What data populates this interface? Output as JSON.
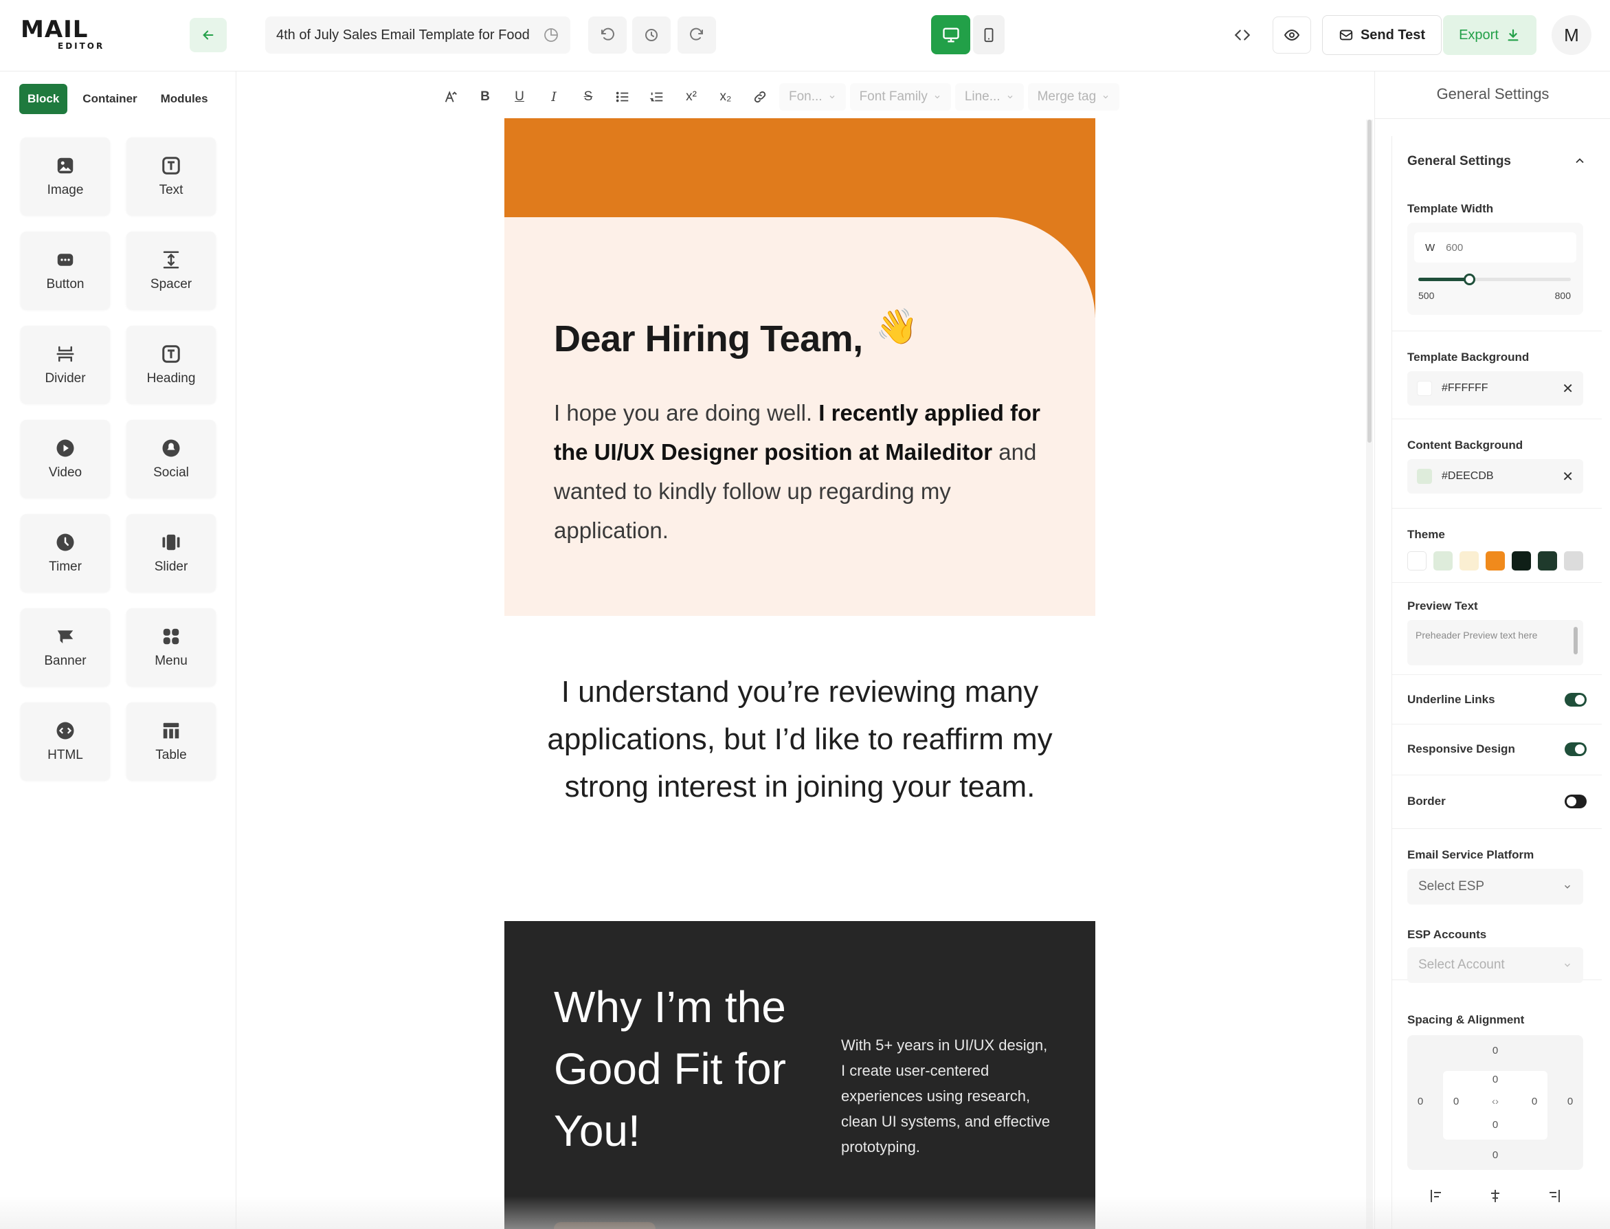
{
  "app": {
    "logo": {
      "main": "MAIL",
      "sub": "EDITOR"
    },
    "template_title": "4th of July Sales Email Template for Food",
    "send_test_label": "Send Test",
    "export_label": "Export",
    "avatar_letter": "M"
  },
  "left": {
    "tabs": [
      "Block",
      "Container",
      "Modules"
    ],
    "blocks": [
      "Image",
      "Text",
      "Button",
      "Spacer",
      "Divider",
      "Heading",
      "Video",
      "Social",
      "Timer",
      "Slider",
      "Banner",
      "Menu",
      "HTML",
      "Table"
    ]
  },
  "toolbar": {
    "font_size": "Fon...",
    "font_family": "Font Family",
    "line_height": "Line...",
    "merge_tag": "Merge tag"
  },
  "email": {
    "greeting": "Dear Hiring Team,",
    "greeting_emoji": "👋",
    "intro_plain": "I hope you are doing well.",
    "intro_bold": "I recently applied for the UI/UX Designer position at Maileditor",
    "intro_rest": "and wanted to kindly follow up regarding my application.",
    "middle": "I understand you’re reviewing many applications, but I’d like to reaffirm my strong interest in joining your team.",
    "why_title": "Why I’m the Good Fit for You!",
    "why_desc": "With 5+ years in UI/UX design, I create user-centered experiences using research, clean UI systems, and effective prototyping."
  },
  "settings": {
    "panel_title": "General Settings",
    "section_title": "General Settings",
    "template_width": {
      "label": "Template Width",
      "prefix": "W",
      "value": 600,
      "min": 500,
      "max": 800
    },
    "template_background": {
      "label": "Template Background",
      "value": "#FFFFFF"
    },
    "content_background": {
      "label": "Content Background",
      "value": "#DEECDB"
    },
    "theme": {
      "label": "Theme",
      "colors": [
        "#FFFFFF",
        "#DEECDB",
        "#FBEFD2",
        "#F08A1C",
        "#0F1F17",
        "#1F3A2C",
        "#DCDCDC"
      ]
    },
    "preview_text": {
      "label": "Preview Text",
      "placeholder": "Preheader Preview text here"
    },
    "underline_links": {
      "label": "Underline Links",
      "on": true
    },
    "responsive_design": {
      "label": "Responsive Design",
      "on": true
    },
    "border": {
      "label": "Border",
      "on": false
    },
    "esp": {
      "label": "Email Service Platform",
      "placeholder": "Select ESP"
    },
    "esp_accounts": {
      "label": "ESP Accounts",
      "placeholder": "Select Account"
    },
    "spacing": {
      "label": "Spacing & Alignment",
      "outer": {
        "top": "0",
        "right": "0",
        "bottom": "0",
        "left": "0"
      },
      "inner": {
        "top": "0",
        "right": "0",
        "bottom": "0",
        "left": "0"
      }
    }
  },
  "colors": {
    "accent": "#1F7A3E",
    "orange": "#E07B1C",
    "peach": "#FDF0E8",
    "dark": "#262626"
  }
}
